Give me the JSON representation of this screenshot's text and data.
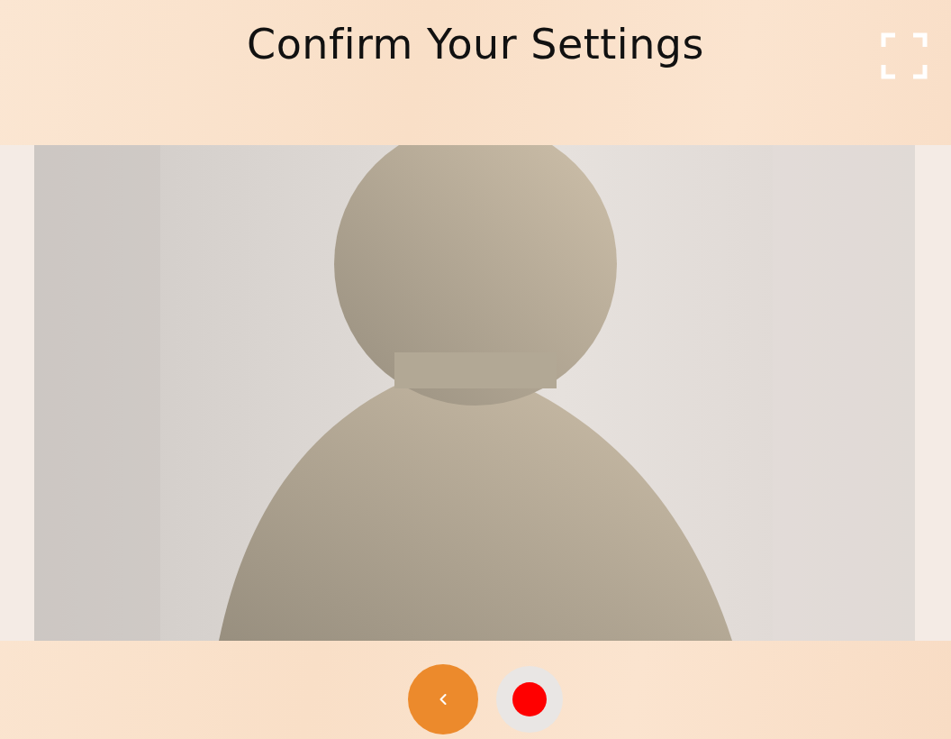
{
  "title": "Confirm Your Settings",
  "controls": [
    {
      "kind": "back"
    },
    {
      "kind": "record"
    }
  ]
}
